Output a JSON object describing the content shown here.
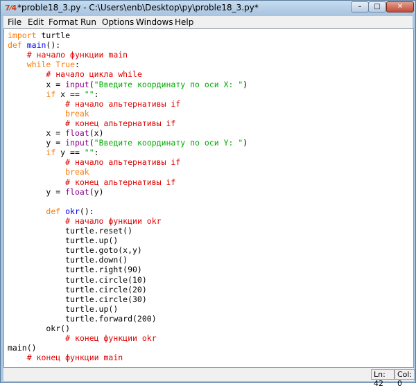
{
  "window": {
    "title": "*proble18_3.py - C:\\Users\\enb\\Desktop\\py\\proble18_3.py*",
    "icon_glyph": "7⁄4",
    "minimize": "–",
    "maximize": "□",
    "close": "✕"
  },
  "menu": [
    "File",
    "Edit",
    "Format",
    "Run",
    "Options",
    "Windows",
    "Help"
  ],
  "code": [
    [
      {
        "t": "import",
        "c": "kw"
      },
      {
        "t": " turtle"
      }
    ],
    [
      {
        "t": "def",
        "c": "kw"
      },
      {
        "t": " "
      },
      {
        "t": "main",
        "c": "fn"
      },
      {
        "t": "():"
      }
    ],
    [
      {
        "t": "    "
      },
      {
        "t": "# начало функции main",
        "c": "cm"
      }
    ],
    [
      {
        "t": "    "
      },
      {
        "t": "while",
        "c": "kw"
      },
      {
        "t": " "
      },
      {
        "t": "True",
        "c": "kw"
      },
      {
        "t": ":"
      }
    ],
    [
      {
        "t": "        "
      },
      {
        "t": "# начало цикла while",
        "c": "cm"
      }
    ],
    [
      {
        "t": "        x = "
      },
      {
        "t": "input",
        "c": "bi"
      },
      {
        "t": "("
      },
      {
        "t": "\"Введите координату по оси X: \"",
        "c": "str"
      },
      {
        "t": ")"
      }
    ],
    [
      {
        "t": "        "
      },
      {
        "t": "if",
        "c": "kw"
      },
      {
        "t": " x == "
      },
      {
        "t": "\"\"",
        "c": "str"
      },
      {
        "t": ":"
      }
    ],
    [
      {
        "t": "            "
      },
      {
        "t": "# начало альтернативы if",
        "c": "cm"
      }
    ],
    [
      {
        "t": "            "
      },
      {
        "t": "break",
        "c": "kw"
      }
    ],
    [
      {
        "t": "            "
      },
      {
        "t": "# конец альтернативы if",
        "c": "cm"
      }
    ],
    [
      {
        "t": "        x = "
      },
      {
        "t": "float",
        "c": "bi"
      },
      {
        "t": "(x)"
      }
    ],
    [
      {
        "t": "        y = "
      },
      {
        "t": "input",
        "c": "bi"
      },
      {
        "t": "("
      },
      {
        "t": "\"Введите координату по оси Y: \"",
        "c": "str"
      },
      {
        "t": ")"
      }
    ],
    [
      {
        "t": "        "
      },
      {
        "t": "if",
        "c": "kw"
      },
      {
        "t": " y == "
      },
      {
        "t": "\"\"",
        "c": "str"
      },
      {
        "t": ":"
      }
    ],
    [
      {
        "t": "            "
      },
      {
        "t": "# начало альтернативы if",
        "c": "cm"
      }
    ],
    [
      {
        "t": "            "
      },
      {
        "t": "break",
        "c": "kw"
      }
    ],
    [
      {
        "t": "            "
      },
      {
        "t": "# конец альтернативы if",
        "c": "cm"
      }
    ],
    [
      {
        "t": "        y = "
      },
      {
        "t": "float",
        "c": "bi"
      },
      {
        "t": "(y)"
      }
    ],
    [
      {
        "t": ""
      }
    ],
    [
      {
        "t": "        "
      },
      {
        "t": "def",
        "c": "kw"
      },
      {
        "t": " "
      },
      {
        "t": "okr",
        "c": "fn"
      },
      {
        "t": "():"
      }
    ],
    [
      {
        "t": "            "
      },
      {
        "t": "# начало функции okr",
        "c": "cm"
      }
    ],
    [
      {
        "t": "            turtle.reset()"
      }
    ],
    [
      {
        "t": "            turtle.up()"
      }
    ],
    [
      {
        "t": "            turtle.goto(x,y)"
      }
    ],
    [
      {
        "t": "            turtle.down()"
      }
    ],
    [
      {
        "t": "            turtle.right(90)"
      }
    ],
    [
      {
        "t": "            turtle.circle(10)"
      }
    ],
    [
      {
        "t": "            turtle.circle(20)"
      }
    ],
    [
      {
        "t": "            turtle.circle(30)"
      }
    ],
    [
      {
        "t": "            turtle.up()"
      }
    ],
    [
      {
        "t": "            turtle.forward(200)"
      }
    ],
    [
      {
        "t": "        okr()"
      }
    ],
    [
      {
        "t": "            "
      },
      {
        "t": "# конец функции okr",
        "c": "cm"
      }
    ],
    [
      {
        "t": "main()"
      }
    ],
    [
      {
        "t": "    "
      },
      {
        "t": "# конец функции main",
        "c": "cm"
      }
    ]
  ],
  "status": {
    "line": "Ln: 42",
    "col": "Col: 0"
  },
  "colors": {
    "keyword": "#ff7700",
    "builtin": "#900090",
    "string": "#00aa00",
    "comment": "#dd0000",
    "definition": "#0000ff"
  }
}
